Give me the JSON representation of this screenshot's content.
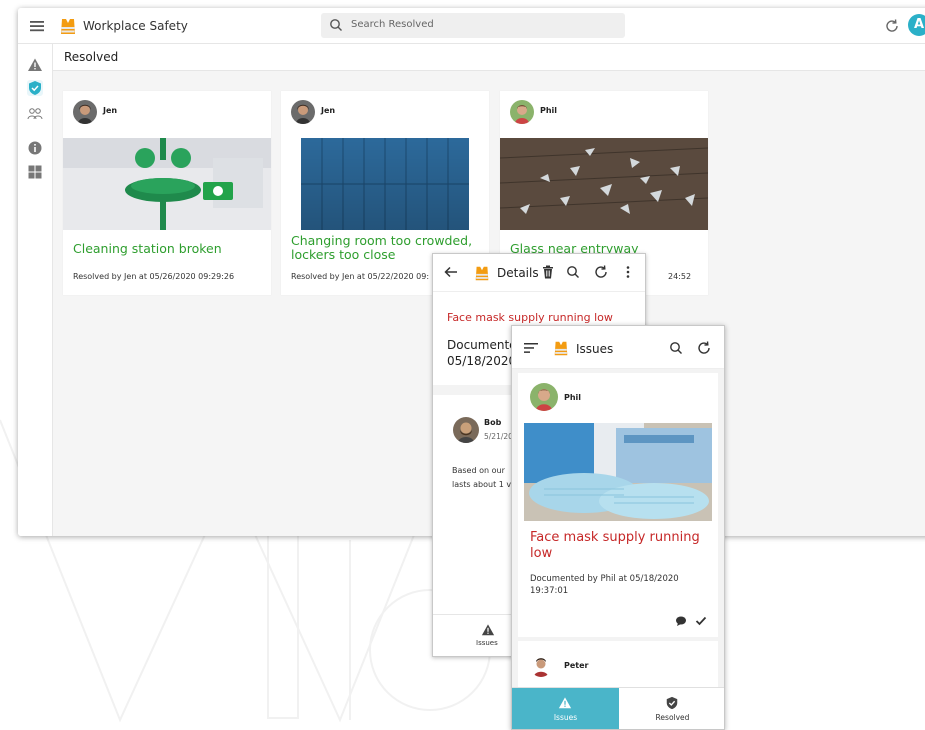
{
  "app": {
    "title": "Workplace Safety",
    "avatar_letter": "A"
  },
  "search": {
    "placeholder": "Search Resolved"
  },
  "page": {
    "title": "Resolved"
  },
  "sidebar": {
    "items": [
      {
        "name": "issues",
        "icon": "warning-icon"
      },
      {
        "name": "resolved",
        "icon": "shield-check-icon",
        "active": true
      },
      {
        "name": "users",
        "icon": "people-icon"
      },
      {
        "name": "info",
        "icon": "info-icon"
      },
      {
        "name": "dashboard",
        "icon": "grid-icon"
      }
    ]
  },
  "cards": [
    {
      "author": "Jen",
      "title": "Cleaning station broken",
      "resolved": "Resolved by Jen at 05/26/2020 09:29:26"
    },
    {
      "author": "Jen",
      "title": "Changing room too crowded, lockers too close",
      "resolved": "Resolved by Jen at 05/22/2020 09:"
    },
    {
      "author": "Phil",
      "title": "Glass near entryway",
      "resolved": "24:52"
    }
  ],
  "details": {
    "title": "Details",
    "issue": "Face mask supply running low",
    "documented": "Documente 05/18/2020",
    "comment": {
      "author": "Bob",
      "date": "5/21/20",
      "text": "Based on our lasts about 1 v"
    },
    "tab_label": "Issues"
  },
  "issues": {
    "title": "Issues",
    "card": {
      "author": "Phil",
      "title": "Face mask supply running low",
      "documented": "Documented by Phil at 05/18/2020 19:37:01"
    },
    "card2": {
      "author": "Peter"
    },
    "tabs": [
      {
        "label": "Issues",
        "active": true
      },
      {
        "label": "Resolved",
        "active": false
      }
    ]
  },
  "colors": {
    "accent": "#4ab5c9",
    "resolved_green": "#2e9e2e",
    "issue_red": "#c62828",
    "avatar_blue": "#2bb0c8"
  }
}
